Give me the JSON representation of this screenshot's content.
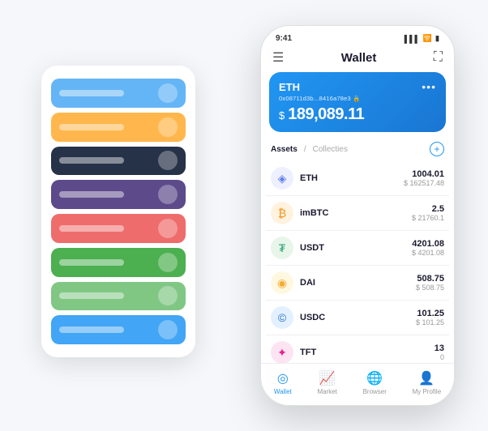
{
  "scene": {
    "background_color": "#f5f7fa"
  },
  "back_panel": {
    "cards": [
      {
        "color": "#64b5f6",
        "label": "",
        "id": "blue-card"
      },
      {
        "color": "#ffb74d",
        "label": "",
        "id": "orange-card"
      },
      {
        "color": "#263248",
        "label": "",
        "id": "dark-card"
      },
      {
        "color": "#5c4a8a",
        "label": "",
        "id": "purple-card"
      },
      {
        "color": "#ef6c6c",
        "label": "",
        "id": "red-card"
      },
      {
        "color": "#4caf50",
        "label": "",
        "id": "green-card"
      },
      {
        "color": "#81c784",
        "label": "",
        "id": "light-green-card"
      },
      {
        "color": "#42a5f5",
        "label": "",
        "id": "blue2-card"
      }
    ]
  },
  "phone": {
    "status_bar": {
      "time": "9:41",
      "signal": "▌▌▌",
      "wifi": "WiFi",
      "battery": "🔋"
    },
    "header": {
      "menu_icon": "☰",
      "title": "Wallet",
      "expand_icon": "⛶"
    },
    "eth_card": {
      "token": "ETH",
      "address": "0x08711d3b...8416a78e3 🔒",
      "balance_symbol": "$",
      "balance": "189,089.11",
      "more_icon": "•••"
    },
    "assets_section": {
      "tab_active": "Assets",
      "tab_divider": "/",
      "tab_inactive": "Collecties",
      "add_icon": "+"
    },
    "assets": [
      {
        "id": "eth",
        "icon": "◈",
        "icon_color": "#627eea",
        "icon_bg": "#eef0ff",
        "name": "ETH",
        "amount": "1004.01",
        "usd": "$ 162517.48"
      },
      {
        "id": "imbtc",
        "icon": "₿",
        "icon_color": "#f7931a",
        "icon_bg": "#fff3e0",
        "name": "imBTC",
        "amount": "2.5",
        "usd": "$ 21760.1"
      },
      {
        "id": "usdt",
        "icon": "₮",
        "icon_color": "#26a17b",
        "icon_bg": "#e8f5e9",
        "name": "USDT",
        "amount": "4201.08",
        "usd": "$ 4201.08"
      },
      {
        "id": "dai",
        "icon": "◉",
        "icon_color": "#f5ac37",
        "icon_bg": "#fff8e1",
        "name": "DAI",
        "amount": "508.75",
        "usd": "$ 508.75"
      },
      {
        "id": "usdc",
        "icon": "©",
        "icon_color": "#2775ca",
        "icon_bg": "#e3f0ff",
        "name": "USDC",
        "amount": "101.25",
        "usd": "$ 101.25"
      },
      {
        "id": "tft",
        "icon": "✦",
        "icon_color": "#e91e8c",
        "icon_bg": "#fce4f3",
        "name": "TFT",
        "amount": "13",
        "usd": "0"
      }
    ],
    "bottom_nav": [
      {
        "id": "wallet",
        "icon": "◎",
        "label": "Wallet",
        "active": true
      },
      {
        "id": "market",
        "icon": "📈",
        "label": "Market",
        "active": false
      },
      {
        "id": "browser",
        "icon": "🌐",
        "label": "Browser",
        "active": false
      },
      {
        "id": "profile",
        "icon": "👤",
        "label": "My Profile",
        "active": false
      }
    ]
  }
}
